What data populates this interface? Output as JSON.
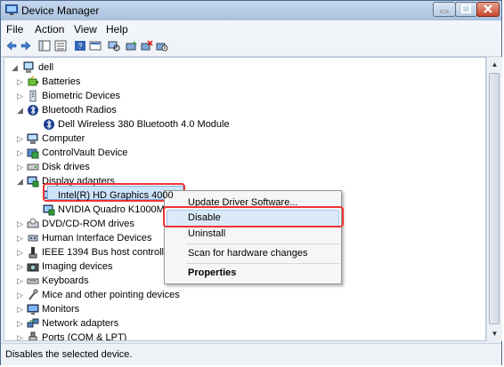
{
  "window": {
    "title": "Device Manager"
  },
  "menu": [
    "File",
    "Action",
    "View",
    "Help"
  ],
  "tree": {
    "root": "dell",
    "rows": [
      {
        "label": "Batteries",
        "icon": "battery-icon",
        "depth": 1,
        "expanded": false
      },
      {
        "label": "Biometric Devices",
        "icon": "biometric-icon",
        "depth": 1,
        "expanded": false
      },
      {
        "label": "Bluetooth Radios",
        "icon": "bluetooth-icon",
        "depth": 1,
        "expanded": true
      },
      {
        "label": "Dell Wireless 380 Bluetooth 4.0 Module",
        "icon": "bluetooth-icon",
        "depth": 2,
        "expanded": null
      },
      {
        "label": "Computer",
        "icon": "computer-icon",
        "depth": 1,
        "expanded": false
      },
      {
        "label": "ControlVault Device",
        "icon": "controlvault-icon",
        "depth": 1,
        "expanded": false
      },
      {
        "label": "Disk drives",
        "icon": "disk-drive-icon",
        "depth": 1,
        "expanded": false
      },
      {
        "label": "Display adapters",
        "icon": "display-adapter-icon",
        "depth": 1,
        "expanded": true
      },
      {
        "label": "Intel(R) HD Graphics 4000",
        "icon": "display-adapter-icon",
        "depth": 2,
        "expanded": null
      },
      {
        "label": "NVIDIA Quadro K1000M",
        "icon": "display-adapter-icon",
        "depth": 2,
        "expanded": null
      },
      {
        "label": "DVD/CD-ROM drives",
        "icon": "dvd-drive-icon",
        "depth": 1,
        "expanded": false
      },
      {
        "label": "Human Interface Devices",
        "icon": "hid-icon",
        "depth": 1,
        "expanded": false
      },
      {
        "label": "IEEE 1394 Bus host controllers",
        "icon": "ieee1394-icon",
        "depth": 1,
        "expanded": false
      },
      {
        "label": "Imaging devices",
        "icon": "camera-icon",
        "depth": 1,
        "expanded": false
      },
      {
        "label": "Keyboards",
        "icon": "keyboard-icon",
        "depth": 1,
        "expanded": false
      },
      {
        "label": "Mice and other pointing devices",
        "icon": "mouse-icon",
        "depth": 1,
        "expanded": false
      },
      {
        "label": "Monitors",
        "icon": "monitor-icon",
        "depth": 1,
        "expanded": false
      },
      {
        "label": "Network adapters",
        "icon": "network-icon",
        "depth": 1,
        "expanded": false
      },
      {
        "label": "Ports (COM & LPT)",
        "icon": "port-icon",
        "depth": 1,
        "expanded": false
      }
    ]
  },
  "context_menu": {
    "items": [
      "Update Driver Software...",
      "Disable",
      "Uninstall",
      "Scan for hardware changes",
      "Properties"
    ]
  },
  "status": {
    "text": "Disables the selected device."
  }
}
